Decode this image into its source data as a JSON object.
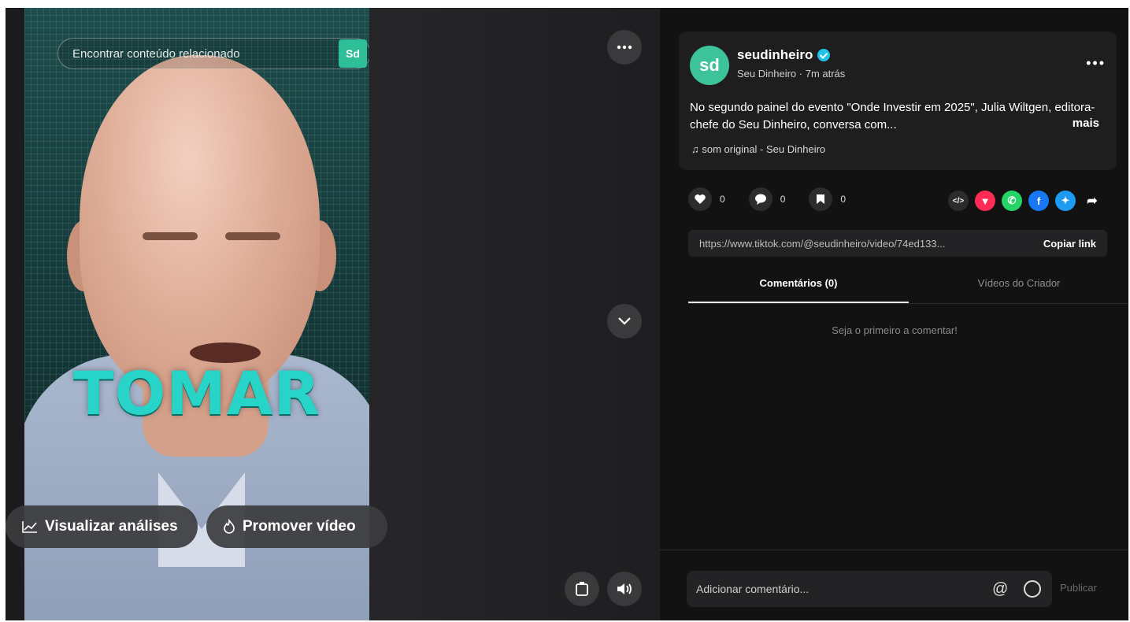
{
  "video": {
    "related_search_placeholder": "Encontrar conteúdo relacionado",
    "related_thumb_text": "Sd",
    "overlay_word": "TOMAR",
    "analytics_label": "Visualizar análises",
    "promote_label": "Promover vídeo"
  },
  "post": {
    "avatar_text": "sd",
    "username": "seudinheiro",
    "subline": "Seu Dinheiro · 7m atrás",
    "caption": "No segundo painel do evento \"Onde Investir em 2025\", Julia Wiltgen, editora-chefe do Seu Dinheiro, conversa com...",
    "more_label": "mais",
    "sound": "♫  som original - Seu Dinheiro",
    "likes": "0",
    "comments": "0",
    "saves": "0",
    "link_url": "https://www.tiktok.com/@seudinheiro/video/74ed133...",
    "copy_link_label": "Copiar link"
  },
  "tabs": {
    "comments": "Comentários (0)",
    "creator_videos": "Vídeos do Criador"
  },
  "empty_message": "Seja o primeiro a comentar!",
  "comment_bar": {
    "placeholder": "Adicionar comentário...",
    "publish_label": "Publicar"
  },
  "colors": {
    "accent_teal": "#28d3c8",
    "verified": "#20c3e8",
    "avatar": "#3cc39a"
  }
}
